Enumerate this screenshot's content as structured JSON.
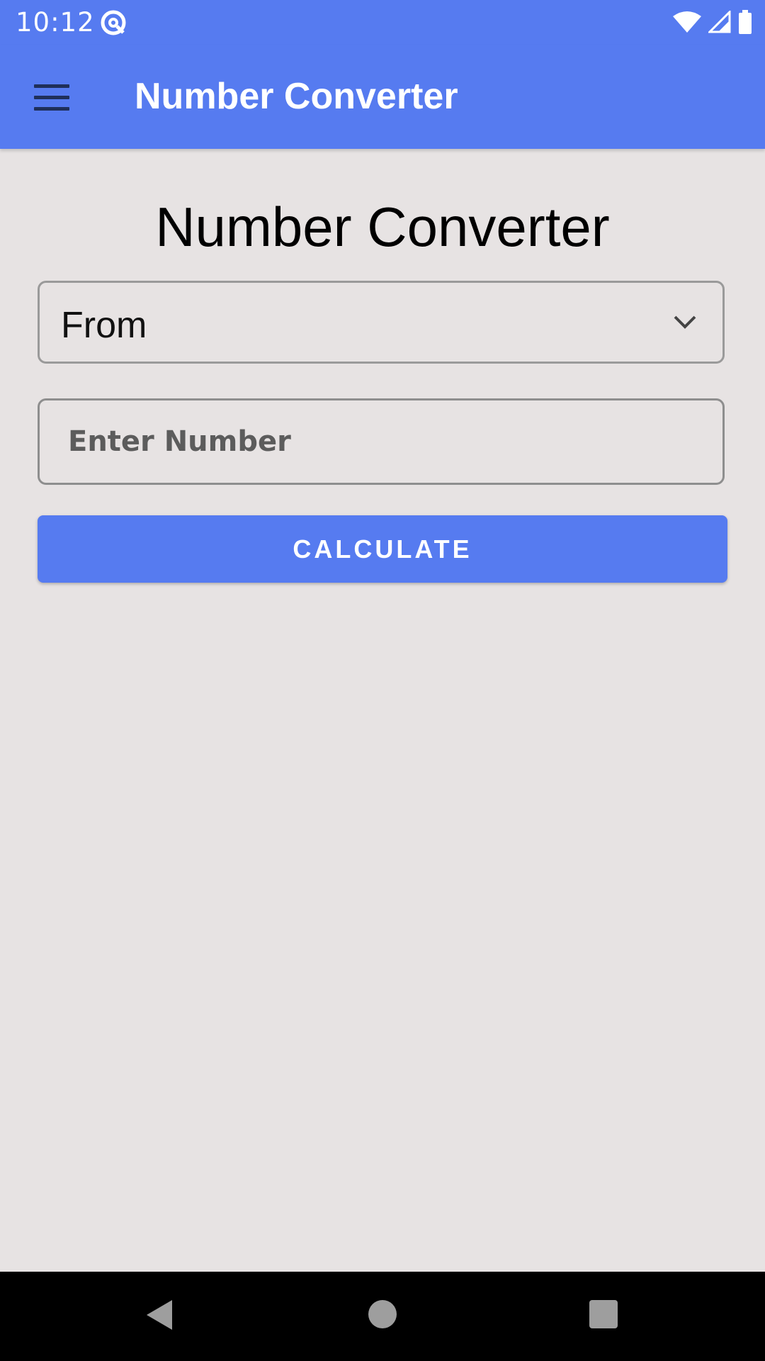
{
  "status_bar": {
    "time": "10:12",
    "app_icon": "at-sign-icon",
    "right_icons": [
      "wifi-icon",
      "cell-signal-icon",
      "battery-icon"
    ]
  },
  "toolbar": {
    "menu_icon": "hamburger-menu-icon",
    "title": "Number Converter"
  },
  "main": {
    "heading": "Number Converter",
    "from_select": {
      "selected_value": "From",
      "icon": "chevron-down-icon"
    },
    "number_input": {
      "value": "",
      "placeholder": "Enter Number"
    },
    "calculate_button": {
      "label": "CALCULATE"
    }
  },
  "nav_bar": {
    "icons": [
      "back-icon",
      "home-icon",
      "recents-icon"
    ]
  },
  "colors": {
    "accent": "#567bf0",
    "background": "#e7e3e3",
    "nav_bar": "#000000"
  }
}
